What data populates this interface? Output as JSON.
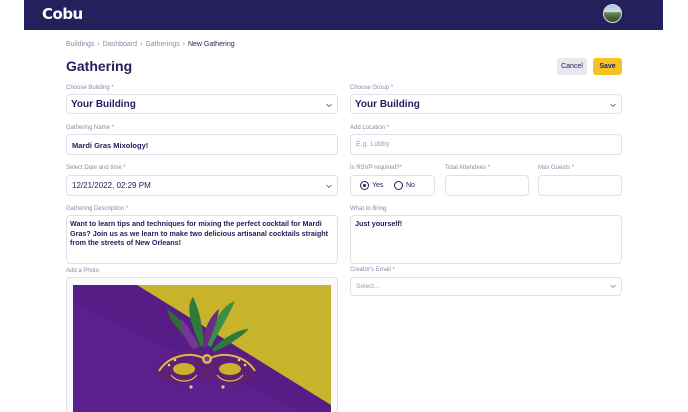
{
  "app": {
    "logo": "Cobu"
  },
  "breadcrumbs": [
    "Buildings",
    "Dashboard",
    "Gatherings",
    "New Gathering"
  ],
  "page": {
    "title": "Gathering"
  },
  "actions": {
    "cancel": "Cancel",
    "save": "Save"
  },
  "form": {
    "building": {
      "label": "Choose Building *",
      "value": "Your Building"
    },
    "group": {
      "label": "Choose Group *",
      "value": "Your Building"
    },
    "name": {
      "label": "Gathering Name *",
      "value": "Mardi Gras Mixology!"
    },
    "location": {
      "label": "Add Location *",
      "placeholder": "E.g. Lobby"
    },
    "datetime": {
      "label": "Select Date and time *",
      "value": "12/21/2022, 02:29 PM"
    },
    "rsvp": {
      "label": "Is RSVP required?*",
      "yes": "Yes",
      "no": "No",
      "selected": "Yes"
    },
    "attendees": {
      "label": "Total Attendees *",
      "value": ""
    },
    "max_guests": {
      "label": "Max Guests *",
      "value": ""
    },
    "description": {
      "label": "Gathering Description *",
      "value": "Want to learn tips and techniques for mixing the perfect cocktail for Mardi Gras? Join us as we learn to make two delicious artisanal cocktails straight from the streets of New Orleans!"
    },
    "bring": {
      "label": "What to Bring",
      "value": "Just yourself!"
    },
    "photo": {
      "label": "Add a Photo"
    },
    "email": {
      "label": "Creator's Email *",
      "placeholder": "Select..."
    }
  },
  "colors": {
    "navy": "#23205c",
    "accent": "#f6c324",
    "photo_purple": "#5a1f8c",
    "photo_yellow": "#c9b52a"
  },
  "icons": [
    "chevron-down-icon",
    "breadcrumb-separator-icon",
    "avatar-image"
  ]
}
